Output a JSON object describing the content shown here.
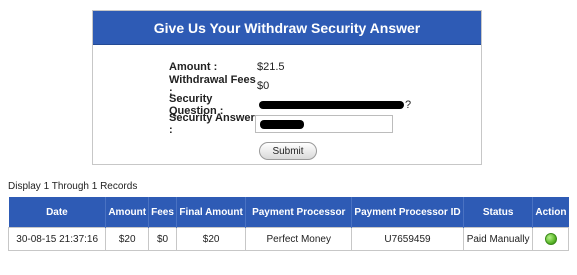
{
  "panel": {
    "title": "Give Us Your Withdraw Security Answer",
    "amount_label": "Amount :",
    "amount_value": "$21.5",
    "fees_label": "Withdrawal Fees :",
    "fees_value": "$0",
    "question_label": "Security Question :",
    "question_suffix": "?",
    "answer_label": "Security Answer :",
    "submit_label": "Submit"
  },
  "records": {
    "caption": "Display 1 Through 1 Records",
    "columns": [
      "Date",
      "Amount",
      "Fees",
      "Final Amount",
      "Payment Processor",
      "Payment Processor ID",
      "Status",
      "Action"
    ],
    "rows": [
      {
        "date": "30-08-15 21:37:16",
        "amount": "$20",
        "fees": "$0",
        "final_amount": "$20",
        "processor": "Perfect Money",
        "processor_id": "U7659459",
        "status": "Paid Manually",
        "action_icon": "green-status-icon"
      }
    ]
  },
  "colors": {
    "header_blue": "#2e5bb5",
    "status_green": "#5cb82a"
  }
}
